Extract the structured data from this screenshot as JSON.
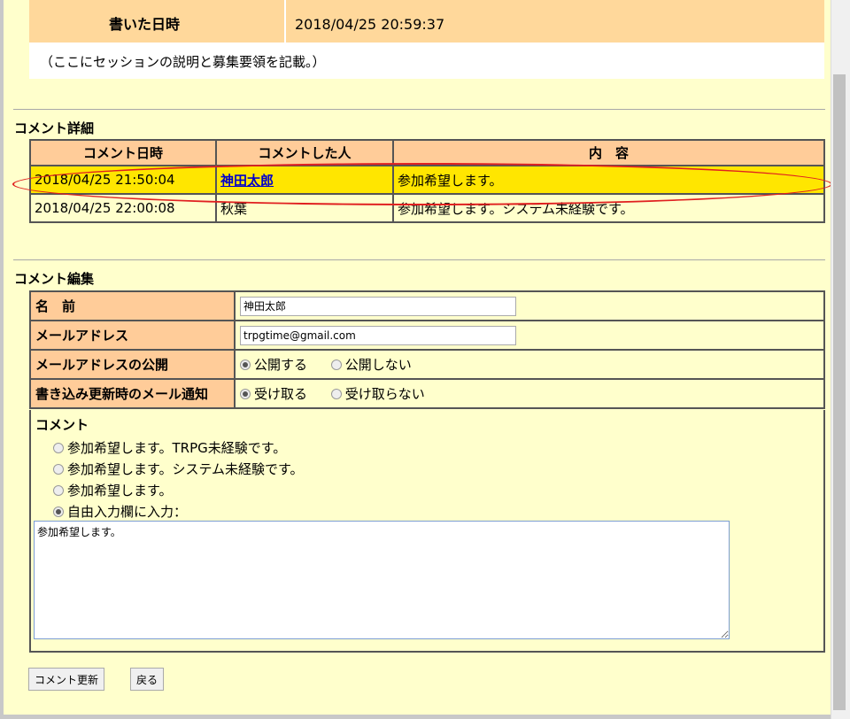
{
  "session_info": {
    "written_label": "書いた日時",
    "written_value": "2018/04/25 20:59:37",
    "description": "（ここにセッションの説明と募集要領を記載。）"
  },
  "comment_details": {
    "title": "コメント詳細",
    "headers": [
      "コメント日時",
      "コメントした人",
      "内　容"
    ],
    "rows": [
      {
        "date": "2018/04/25 21:50:04",
        "person": "神田太郎",
        "content": "参加希望します。",
        "highlighted": true
      },
      {
        "date": "2018/04/25 22:00:08",
        "person": "秋葉",
        "content": "参加希望します。システム未経験です。",
        "highlighted": false
      }
    ]
  },
  "comment_edit": {
    "title": "コメント編集",
    "name_label": "名　前",
    "name_value": "神田太郎",
    "email_label": "メールアドレス",
    "email_value": "trpgtime@gmail.com",
    "email_public_label": "メールアドレスの公開",
    "email_public_options": [
      "公開する",
      "公開しない"
    ],
    "email_public_selected": "公開する",
    "notify_label": "書き込み更新時のメール通知",
    "notify_options": [
      "受け取る",
      "受け取らない"
    ],
    "notify_selected": "受け取る",
    "comment_label": "コメント",
    "comment_options": [
      "参加希望します。TRPG未経験です。",
      "参加希望します。システム未経験です。",
      "参加希望します。",
      "自由入力欄に入力："
    ],
    "comment_selected": "自由入力欄に入力：",
    "comment_text": "参加希望します。"
  },
  "buttons": {
    "update": "コメント更新",
    "back": "戻る"
  },
  "colors": {
    "page_bg": "#ffffcc",
    "header_bg": "#ffcc99",
    "highlight_row": "#ffe600",
    "annotation": "#e02020"
  }
}
